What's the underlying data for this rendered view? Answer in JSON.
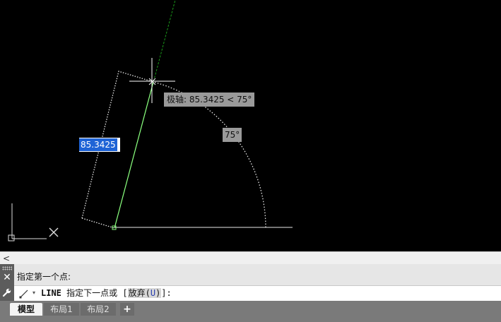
{
  "canvas": {
    "polar_tooltip": "极轴: 85.3425 < 75°",
    "angle_label": "75°",
    "length_input": "85.3425"
  },
  "scrollbar": {
    "left_arrow": "<"
  },
  "command": {
    "history": "指定第一个点:",
    "keyword": "LINE",
    "prompt": " 指定下一点或 [",
    "option_label": "放弃(",
    "option_key": "U",
    "option_close": ")",
    "suffix": "]:",
    "dropdown_arrow": "▾",
    "close_glyph": "✕"
  },
  "tabs": {
    "model": "模型",
    "layout1": "布局1",
    "layout2": "布局2",
    "add": "+"
  },
  "colors": {
    "canvas_bg": "#000000",
    "rubber_band": "#8cff80",
    "polar_track": "#1a9a1a",
    "geometry": "#ffffff"
  },
  "icons": [
    "close-icon",
    "wrench-icon",
    "line-command-icon",
    "grip-handle",
    "ucs-icon",
    "crosshair-cursor"
  ]
}
